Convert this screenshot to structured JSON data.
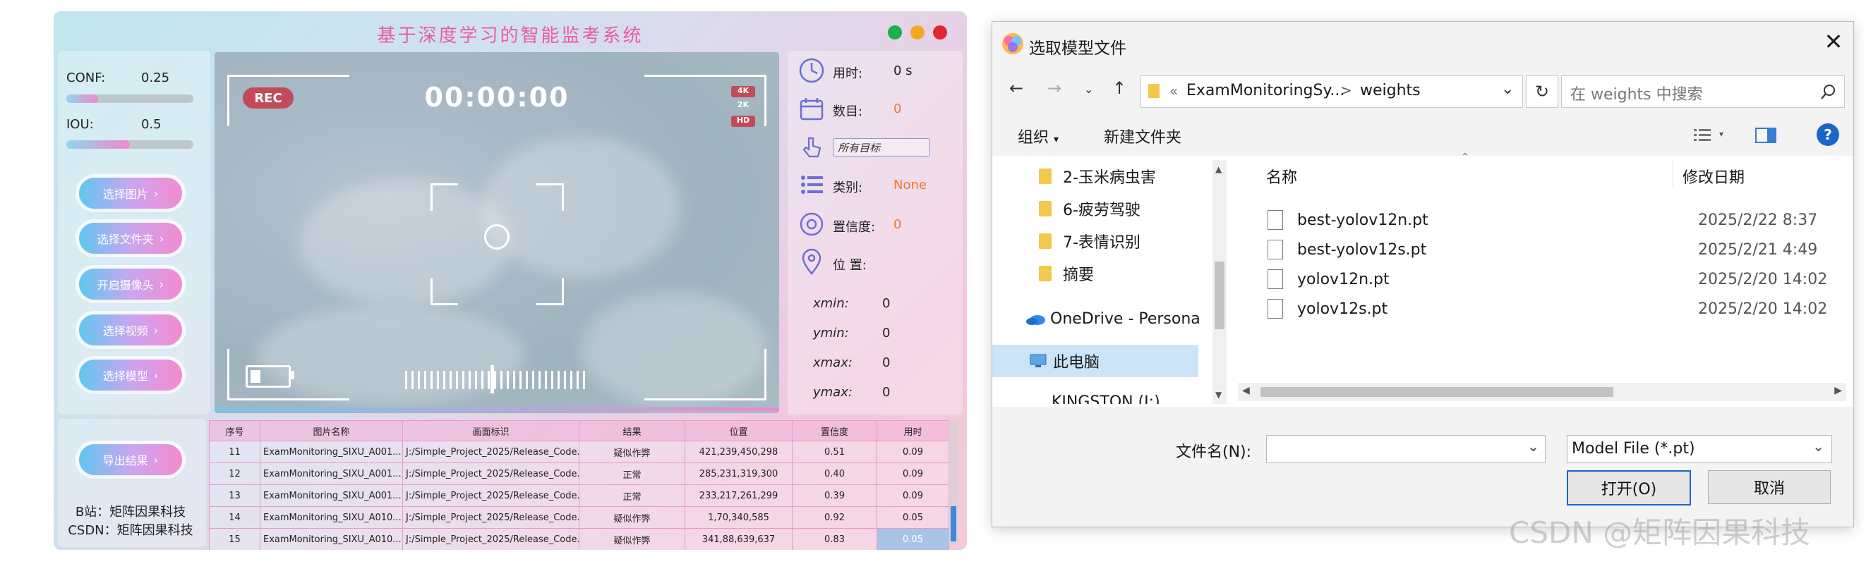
{
  "app": {
    "title": "基于深度学习的智能监考系统",
    "traffic_lights": [
      "#1db04a",
      "#f5a623",
      "#e0282e"
    ],
    "conf": {
      "label": "CONF:",
      "value": "0.25",
      "level": 0.25
    },
    "iou": {
      "label": "IOU:",
      "value": "0.5",
      "level": 0.5
    },
    "buttons": [
      "选择图片",
      "选择文件夹",
      "开启摄像头",
      "选择视频",
      "选择模型"
    ],
    "export_button": "导出结果",
    "footer": {
      "bilibili": "B站：矩阵因果科技",
      "csdn": "CSDN：矩阵因果科技"
    },
    "video": {
      "rec": "REC",
      "timer": "00:00:00",
      "badges": [
        "4K",
        "2K",
        "HD"
      ]
    },
    "info": {
      "time_label": "用时:",
      "time_value": "0 s",
      "count_label": "数目:",
      "count_value": "0",
      "target_placeholder": "所有目标",
      "class_label": "类别:",
      "class_value": "None",
      "conf_label": "置信度:",
      "conf_value": "0",
      "pos_label": "位 置:",
      "coords": [
        {
          "label": "xmin:",
          "value": "0"
        },
        {
          "label": "ymin:",
          "value": "0"
        },
        {
          "label": "xmax:",
          "value": "0"
        },
        {
          "label": "ymax:",
          "value": "0"
        }
      ]
    },
    "table": {
      "headers": [
        "序号",
        "图片名称",
        "画面标识",
        "结果",
        "位置",
        "置信度",
        "用时"
      ],
      "rows": [
        [
          "11",
          "ExamMonitoring_SIXU_A001...",
          "J:/Simple_Project_2025/Release_Code...",
          "疑似作弊",
          "421,239,450,298",
          "0.51",
          "0.09"
        ],
        [
          "12",
          "ExamMonitoring_SIXU_A001...",
          "J:/Simple_Project_2025/Release_Code...",
          "正常",
          "285,231,319,300",
          "0.40",
          "0.09"
        ],
        [
          "13",
          "ExamMonitoring_SIXU_A001...",
          "J:/Simple_Project_2025/Release_Code...",
          "正常",
          "233,217,261,299",
          "0.39",
          "0.09"
        ],
        [
          "14",
          "ExamMonitoring_SIXU_A010...",
          "J:/Simple_Project_2025/Release_Code...",
          "疑似作弊",
          "1,70,340,585",
          "0.92",
          "0.05"
        ],
        [
          "15",
          "ExamMonitoring_SIXU_A010...",
          "J:/Simple_Project_2025/Release_Code...",
          "疑似作弊",
          "341,88,639,637",
          "0.83",
          "0.05"
        ]
      ]
    }
  },
  "dialog": {
    "title": "选取模型文件",
    "breadcrumb": {
      "prefix": "«",
      "parent": "ExamMonitoringSy...",
      "sep": ">",
      "current": "weights"
    },
    "search_placeholder": "在 weights 中搜索",
    "toolbar": {
      "organize": "组织",
      "new_folder": "新建文件夹"
    },
    "tree": [
      "2-玉米病虫害",
      "6-疲劳驾驶",
      "7-表情识别",
      "摘要",
      "OneDrive - Persona",
      "此电脑",
      "KINGSTON (I:)"
    ],
    "columns": {
      "name": "名称",
      "date": "修改日期"
    },
    "files": [
      {
        "name": "best-yolov12n.pt",
        "date": "2025/2/22 8:37"
      },
      {
        "name": "best-yolov12s.pt",
        "date": "2025/2/21 4:49"
      },
      {
        "name": "yolov12n.pt",
        "date": "2025/2/20 14:02"
      },
      {
        "name": "yolov12s.pt",
        "date": "2025/2/20 14:02"
      }
    ],
    "filename_label": "文件名(N):",
    "filename_value": "",
    "filter": "Model File (*.pt)",
    "open_button": "打开(O)",
    "cancel_button": "取消"
  },
  "watermark": "CSDN @矩阵因果科技"
}
